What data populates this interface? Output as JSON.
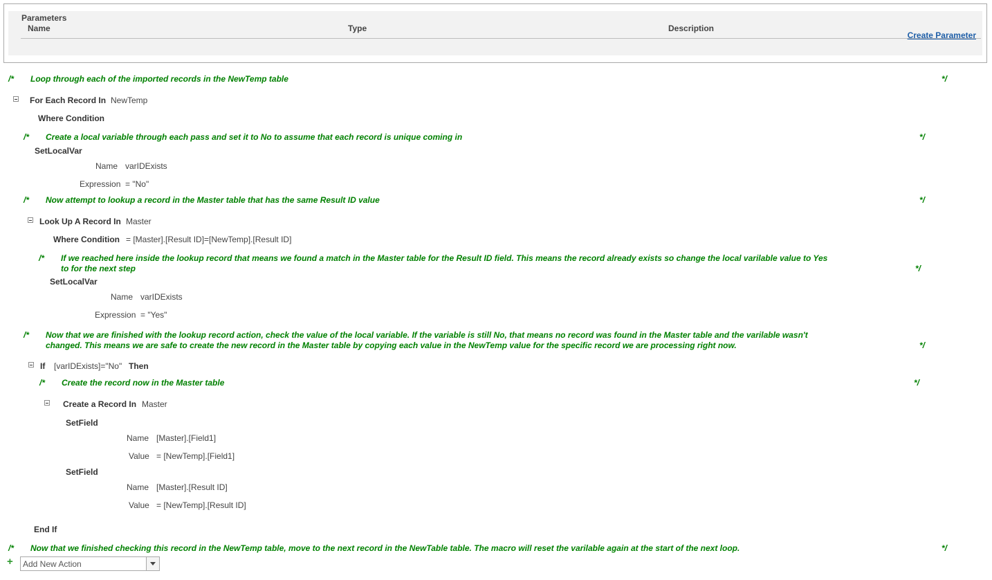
{
  "parameters": {
    "title": "Parameters",
    "col_name": "Name",
    "col_type": "Type",
    "col_description": "Description",
    "create_link": "Create Parameter"
  },
  "comment_open": "/*",
  "comment_close": "*/",
  "comments": {
    "c1": "Loop through each of the imported records in the NewTemp table",
    "c2": "Create a local variable through each pass and set it to No to assume that each record is unique coming in",
    "c3": "Now attempt to lookup a record in the Master table that has the same Result ID value",
    "c4_line1": "If we reached here inside the lookup record that means we found a match in the Master table for the Result ID field. This means the record already exists so change the local varilable value to Yes",
    "c4_line2": "to for the next step",
    "c5_line1": "Now that we are finished with the lookup record action, check the value of the local variable. If the variable is still No, that means no record was found in the Master table and the varilable wasn't",
    "c5_line2": "changed. This means we are safe to create the new record in the Master table by copying each value in the NewTemp value for the specific record we are processing right now.",
    "c6": "Create the record now in the Master table",
    "c7": "Now that we finished checking this record in the NewTemp table, move to the next record in the NewTable table. The macro will reset the varilable again at the start of the next loop."
  },
  "for_each": {
    "keyword": "For Each Record In",
    "table": "NewTemp",
    "where_label": "Where Condition"
  },
  "setlocal1": {
    "keyword": "SetLocalVar",
    "name_label": "Name",
    "name_value": "varIDExists",
    "expr_label": "Expression",
    "expr_value": "= \"No\""
  },
  "lookup": {
    "keyword": "Look Up A Record In",
    "table": "Master",
    "where_label": "Where Condition",
    "where_value": "= [Master].[Result ID]=[NewTemp].[Result ID]"
  },
  "setlocal2": {
    "keyword": "SetLocalVar",
    "name_label": "Name",
    "name_value": "varIDExists",
    "expr_label": "Expression",
    "expr_value": "= \"Yes\""
  },
  "if_block": {
    "keyword_if": "If",
    "condition": "[varIDExists]=\"No\"",
    "keyword_then": "Then",
    "end_if": "End If"
  },
  "create_record": {
    "keyword": "Create a Record In",
    "table": "Master"
  },
  "setfield1": {
    "keyword": "SetField",
    "name_label": "Name",
    "name_value": "[Master].[Field1]",
    "value_label": "Value",
    "value_value": "= [NewTemp].[Field1]"
  },
  "setfield2": {
    "keyword": "SetField",
    "name_label": "Name",
    "name_value": "[Master].[Result ID]",
    "value_label": "Value",
    "value_value": "= [NewTemp].[Result ID]"
  },
  "add_action": {
    "placeholder": "Add New Action"
  }
}
